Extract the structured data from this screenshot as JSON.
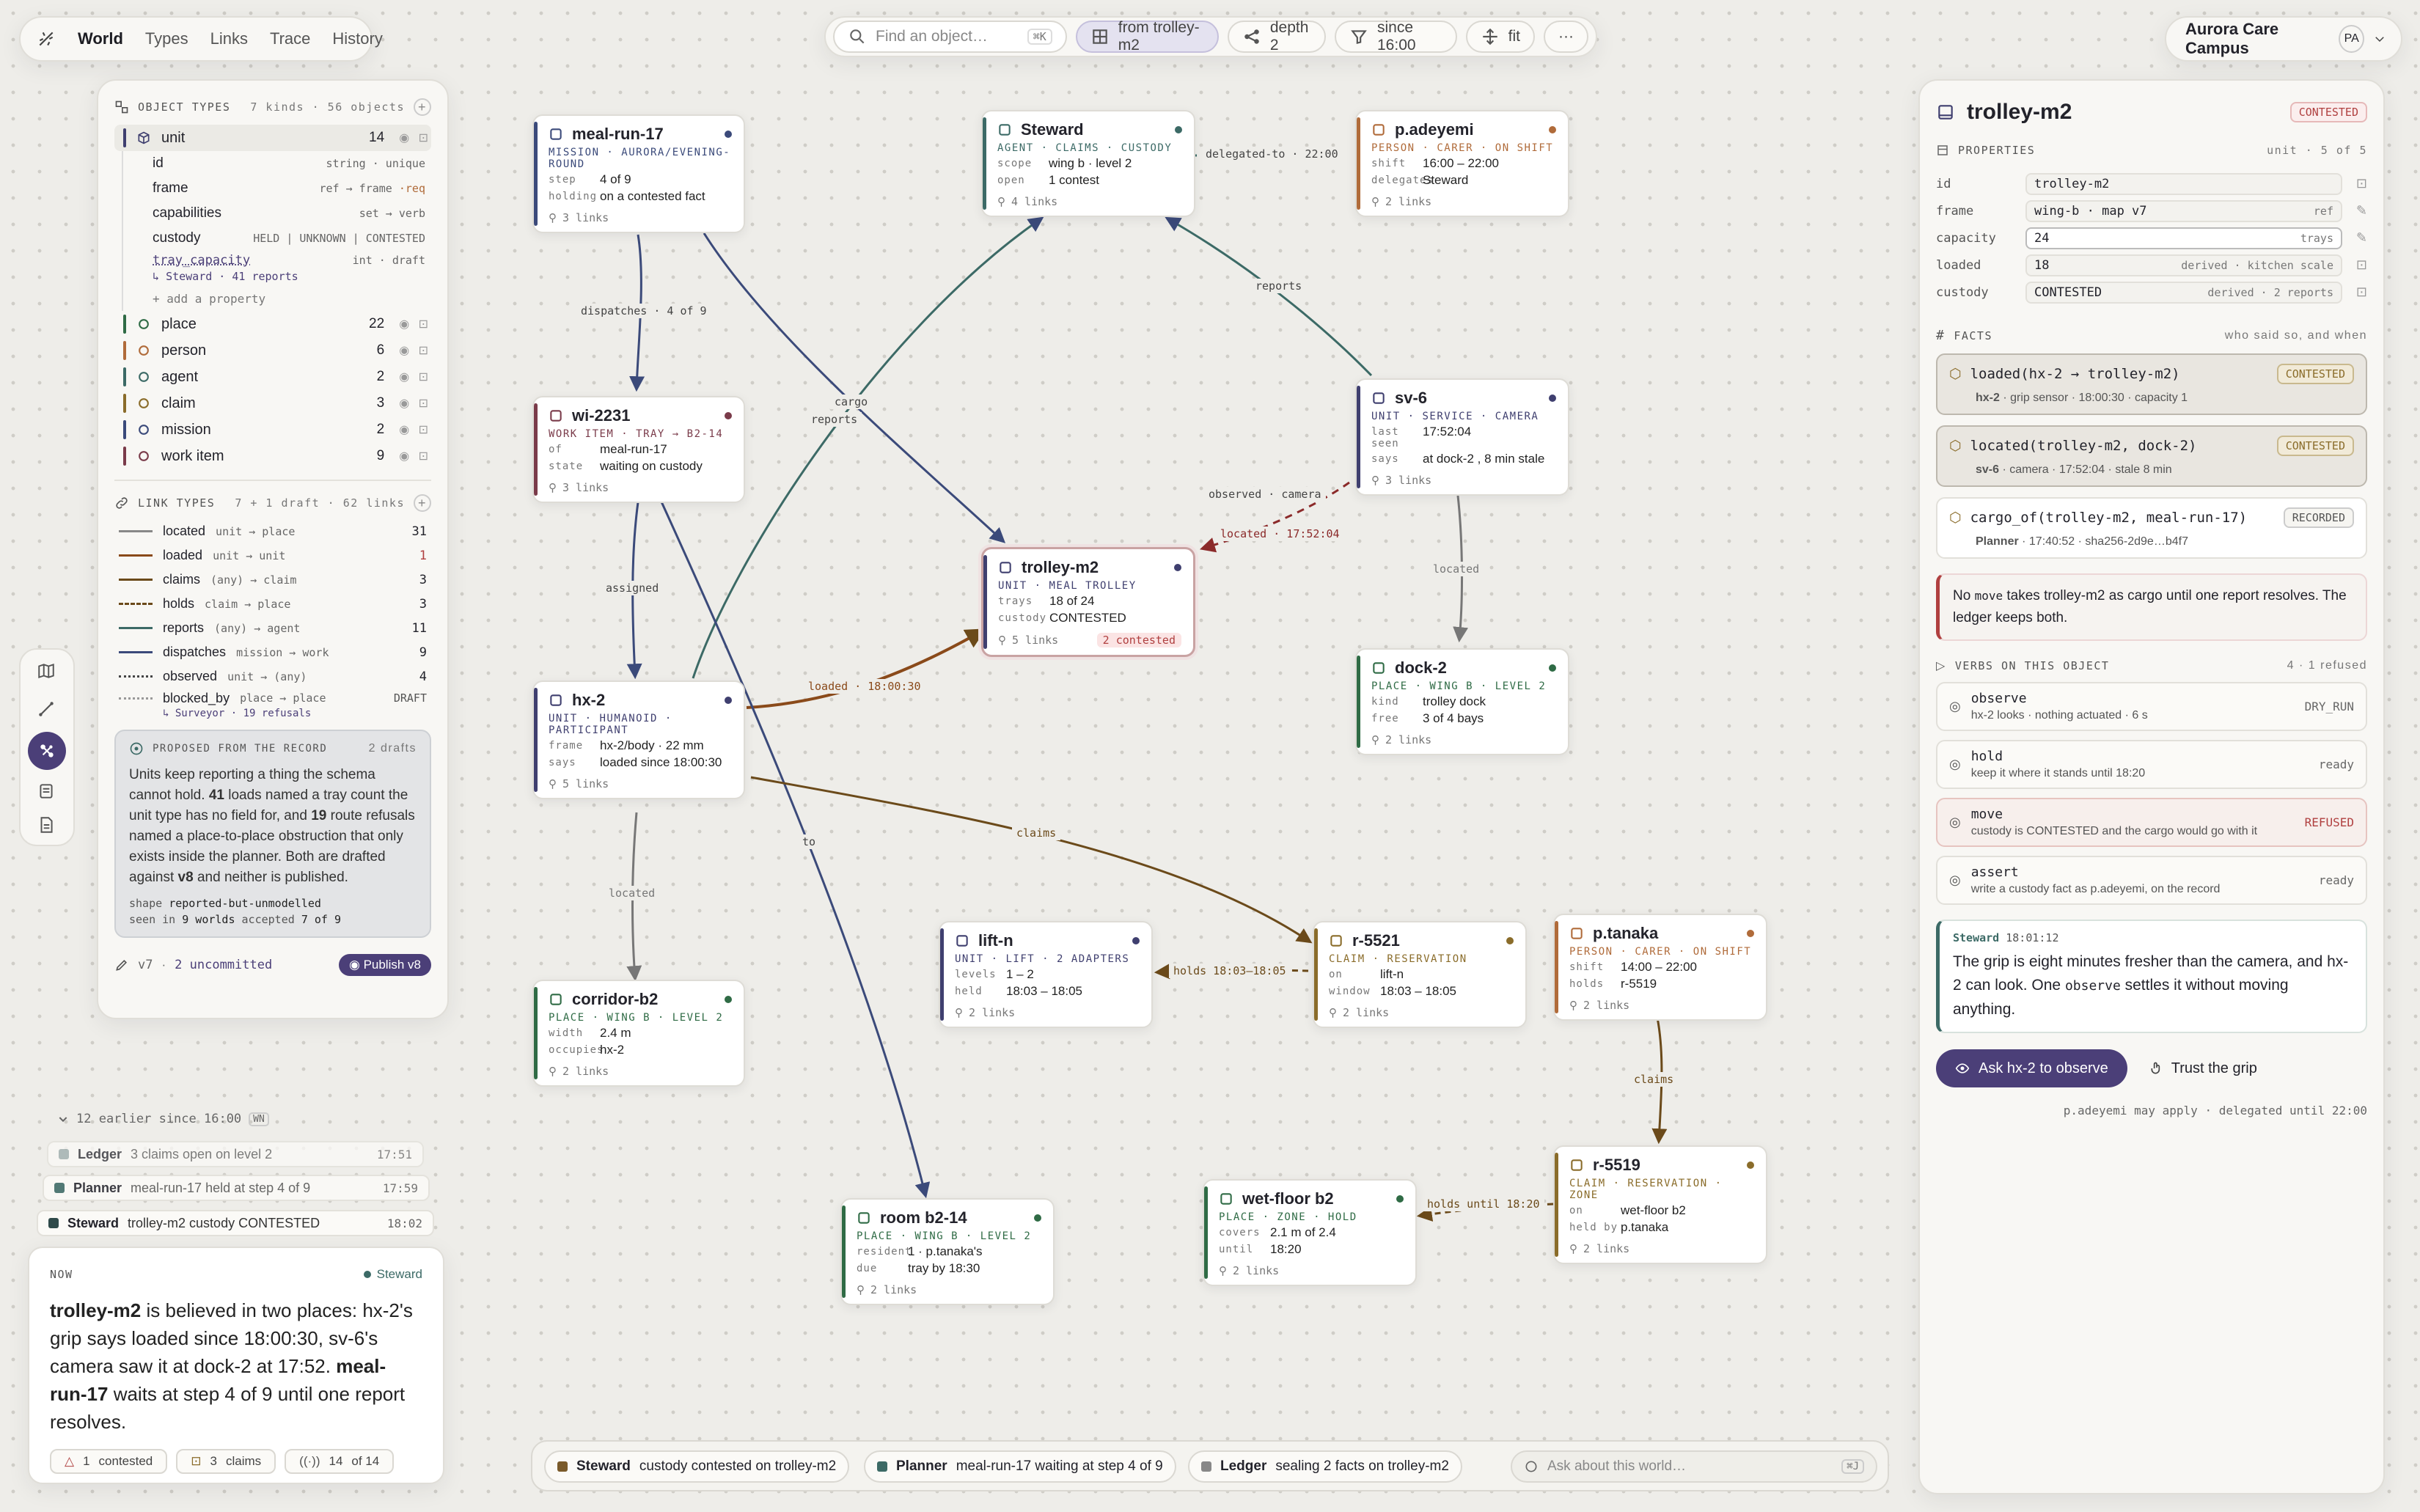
{
  "nav": {
    "title": "World",
    "tabs": [
      "Types",
      "Links",
      "Trace",
      "History"
    ]
  },
  "search": {
    "placeholder": "Find an object…",
    "shortcut": "⌘K",
    "chips": [
      {
        "label": "from trolley-m2"
      },
      {
        "label": "depth 2"
      },
      {
        "label": "since 16:00"
      },
      {
        "label": "fit"
      },
      {
        "label": "···"
      }
    ]
  },
  "campus": {
    "name": "Aurora Care Campus",
    "avatar": "PA"
  },
  "colors": {
    "unit": "#3f3f6f",
    "place": "#2f6b45",
    "person": "#b06b3a",
    "agent": "#3c6a66",
    "claim": "#8a6c2a",
    "mission": "#3b4a7a",
    "work": "#7a3b4a",
    "accent": "#4b3f78",
    "contested": "#b04040"
  },
  "object_types": {
    "header": "OBJECT TYPES",
    "summary": "7 kinds · 56 objects",
    "items": [
      {
        "name": "unit",
        "count": "14"
      },
      {
        "name": "place",
        "count": "22"
      },
      {
        "name": "person",
        "count": "6"
      },
      {
        "name": "agent",
        "count": "2"
      },
      {
        "name": "claim",
        "count": "3"
      },
      {
        "name": "mission",
        "count": "2"
      },
      {
        "name": "work item",
        "count": "9"
      }
    ],
    "unit_props": [
      {
        "name": "id",
        "type": "string · unique"
      },
      {
        "name": "frame",
        "type": "ref → frame ",
        "req": "·req"
      },
      {
        "name": "capabilities",
        "type": "set → verb"
      },
      {
        "name": "custody",
        "type": "HELD | UNKNOWN | CONTESTED"
      }
    ],
    "draft_prop": {
      "name": "tray_capacity",
      "type": "int · draft",
      "note": "Steward · 41 reports"
    },
    "add_prop": "+ add a property"
  },
  "link_types": {
    "header": "LINK TYPES",
    "summary": "7 + 1 draft · 62 links",
    "items": [
      {
        "name": "located",
        "sig": "unit → place",
        "count": "31"
      },
      {
        "name": "loaded",
        "sig": "unit → unit",
        "count": "1"
      },
      {
        "name": "claims",
        "sig": "(any) → claim",
        "count": "3"
      },
      {
        "name": "holds",
        "sig": "claim → place",
        "count": "3"
      },
      {
        "name": "reports",
        "sig": "(any) → agent",
        "count": "11"
      },
      {
        "name": "dispatches",
        "sig": "mission → work",
        "count": "9"
      },
      {
        "name": "observed",
        "sig": "unit → (any)",
        "count": "4"
      }
    ],
    "draft": {
      "name": "blocked_by",
      "sig": "place → place",
      "tag": "DRAFT",
      "note": "Surveyor · 19 refusals"
    }
  },
  "proposed": {
    "title": "PROPOSED FROM THE RECORD",
    "drafts": "2 drafts",
    "body_a": "Units keep reporting a thing the schema cannot hold. ",
    "n1": "41",
    "body_b": " loads named a tray count the unit type has no field for, and ",
    "n2": "19",
    "body_c": " route refusals named a place-to-place obstruction that only exists inside the planner. Both are drafted against ",
    "v": "v8",
    "body_d": " and neither is published.",
    "shape_label": "shape",
    "shape": "reported-but-unmodelled",
    "seen_a": "seen in",
    "seen_n": "9 worlds",
    "acc_a": "accepted",
    "acc_n": "7 of 9"
  },
  "version": {
    "v": "v7",
    "uncommitted": "2 uncommitted",
    "publish": "Publish v8"
  },
  "nodes": {
    "meal": {
      "name": "meal-run-17",
      "sub": "MISSION · AURORA/EVENING-ROUND",
      "kv": [
        [
          "step",
          "4 of 9"
        ],
        [
          "holding",
          "on a contested fact"
        ]
      ],
      "links": "3 links"
    },
    "steward": {
      "name": "Steward",
      "sub": "AGENT · CLAIMS · CUSTODY",
      "kv": [
        [
          "scope",
          "wing b · level 2"
        ],
        [
          "open",
          "1 contest"
        ]
      ],
      "links": "4 links"
    },
    "adeyemi": {
      "name": "p.adeyemi",
      "sub": "PERSON · CARER · ON SHIFT",
      "kv": [
        [
          "shift",
          "16:00 – 22:00"
        ],
        [
          "delegates",
          "Steward"
        ]
      ],
      "links": "2 links"
    },
    "wi": {
      "name": "wi-2231",
      "sub": "WORK ITEM · TRAY → B2-14",
      "kv": [
        [
          "of",
          "meal-run-17"
        ],
        [
          "state",
          "waiting on custody"
        ]
      ],
      "links": "3 links"
    },
    "sv6": {
      "name": "sv-6",
      "sub": "UNIT · SERVICE · CAMERA",
      "kv": [
        [
          "last seen",
          "17:52:04"
        ],
        [
          "says",
          "at dock-2 , 8 min stale"
        ]
      ],
      "links": "3 links"
    },
    "trolley": {
      "name": "trolley-m2",
      "sub": "UNIT · MEAL TROLLEY",
      "kv": [
        [
          "trays",
          "18 of 24"
        ],
        [
          "custody",
          "CONTESTED"
        ]
      ],
      "links": "5 links",
      "contested": "2 contested"
    },
    "hx2": {
      "name": "hx-2",
      "sub": "UNIT · HUMANOID · PARTICIPANT",
      "kv": [
        [
          "frame",
          "hx-2/body · 22 mm"
        ],
        [
          "says",
          "loaded since 18:00:30"
        ]
      ],
      "links": "5 links"
    },
    "dock": {
      "name": "dock-2",
      "sub": "PLACE · WING B · LEVEL 2",
      "kv": [
        [
          "kind",
          "trolley dock"
        ],
        [
          "free",
          "3 of 4 bays"
        ]
      ],
      "links": "2 links"
    },
    "corridor": {
      "name": "corridor-b2",
      "sub": "PLACE · WING B · LEVEL 2",
      "kv": [
        [
          "width",
          "2.4 m"
        ],
        [
          "occupies",
          "hx-2"
        ]
      ],
      "links": "2 links"
    },
    "lift": {
      "name": "lift-n",
      "sub": "UNIT · LIFT · 2 ADAPTERS",
      "kv": [
        [
          "levels",
          "1 – 2"
        ],
        [
          "held",
          "18:03 – 18:05"
        ]
      ],
      "links": "2 links"
    },
    "r5521": {
      "name": "r-5521",
      "sub": "CLAIM · RESERVATION",
      "kv": [
        [
          "on",
          "lift-n"
        ],
        [
          "window",
          "18:03 – 18:05"
        ]
      ],
      "links": "2 links"
    },
    "tanaka": {
      "name": "p.tanaka",
      "sub": "PERSON · CARER · ON SHIFT",
      "kv": [
        [
          "shift",
          "14:00 – 22:00"
        ],
        [
          "holds",
          "r-5519"
        ]
      ],
      "links": "2 links"
    },
    "room": {
      "name": "room b2-14",
      "sub": "PLACE · WING B · LEVEL 2",
      "kv": [
        [
          "resident",
          "1 · p.tanaka's"
        ],
        [
          "due",
          "tray by 18:30"
        ]
      ],
      "links": "2 links"
    },
    "wetfloor": {
      "name": "wet-floor b2",
      "sub": "PLACE · ZONE · HOLD",
      "kv": [
        [
          "covers",
          "2.1 m of 2.4"
        ],
        [
          "until",
          "18:20"
        ]
      ],
      "links": "2 links"
    },
    "r5519": {
      "name": "r-5519",
      "sub": "CLAIM · RESERVATION · ZONE",
      "kv": [
        [
          "on",
          "wet-floor b2"
        ],
        [
          "held by",
          "p.tanaka"
        ]
      ],
      "links": "2 links"
    }
  },
  "edges": {
    "dispatches": "dispatches · 4 of 9",
    "cargo": "cargo",
    "reports1": "reports",
    "delegated": "delegated-to · 22:00",
    "reports2": "reports",
    "observed": "observed · camera",
    "located1": "located · 17:52:04",
    "located2": "located",
    "assigned": "assigned",
    "loaded": "loaded · 18:00:30",
    "located3": "located",
    "to": "to",
    "claims1": "claims",
    "holds1": "holds 18:03–18:05",
    "claims2": "claims",
    "holds2": "holds until 18:20"
  },
  "history": {
    "toggle": "12 earlier since 16:00",
    "key": "WN",
    "items": [
      {
        "who": "Ledger",
        "what": "3 claims open on level 2",
        "time": "17:51"
      },
      {
        "who": "Planner",
        "what": "meal-run-17 held at step 4 of 9",
        "time": "17:59"
      },
      {
        "who": "Steward",
        "what": "trolley-m2 custody CONTESTED",
        "time": "18:02"
      }
    ]
  },
  "now": {
    "label": "NOW",
    "by": "Steward",
    "t1": "trolley-m2",
    "t2": " is believed in two places: hx-2's grip says loaded since 18:00:30, sv-6's camera saw it at dock-2 at 17:52. ",
    "t3": "meal-run-17",
    "t4": " waits at step 4 of 9 until one report resolves.",
    "chips": [
      {
        "n": "1",
        "l": "contested"
      },
      {
        "n": "3",
        "l": "claims"
      },
      {
        "n": "14",
        "l": "of 14"
      }
    ]
  },
  "bottom": {
    "items": [
      {
        "who": "Steward",
        "what": "custody contested on trolley-m2"
      },
      {
        "who": "Planner",
        "what": "meal-run-17 waiting at step 4 of 9"
      },
      {
        "who": "Ledger",
        "what": "sealing 2 facts on trolley-m2"
      }
    ],
    "ask_placeholder": "Ask about this world…",
    "ask_key": "⌘J"
  },
  "inspector": {
    "title": "trolley-m2",
    "status": "CONTESTED",
    "props_header": "PROPERTIES",
    "props_meta": "unit · 5 of 5",
    "props": [
      {
        "k": "id",
        "v": "trolley-m2",
        "tag": ""
      },
      {
        "k": "frame",
        "v": "wing-b · map v7",
        "tag": "ref"
      },
      {
        "k": "capacity",
        "v": "24",
        "tag": "trays"
      },
      {
        "k": "loaded",
        "v": "18",
        "tag": "derived · kitchen scale"
      },
      {
        "k": "custody",
        "v": "CONTESTED",
        "tag": "derived · 2 reports"
      }
    ],
    "facts_header": "FACTS",
    "facts_meta": "who said so, and when",
    "facts": [
      {
        "t": "loaded(hx-2 → trolley-m2)",
        "status": "CONTESTED",
        "who": "hx-2",
        "src": " · grip sensor · 18:00:30 · capacity 1"
      },
      {
        "t": "located(trolley-m2, dock-2)",
        "status": "CONTESTED",
        "who": "sv-6",
        "src": " · camera · 17:52:04 · stale 8 min"
      },
      {
        "t": "cargo_of(trolley-m2, meal-run-17)",
        "status": "RECORDED",
        "who": "Planner",
        "src": " · 17:40:52 · sha256-2d9e…b4f7"
      }
    ],
    "warn_a": "No ",
    "warn_code": "move",
    "warn_b": " takes trolley-m2 as cargo until one report resolves. The ledger keeps both.",
    "verbs_header": "VERBS ON THIS OBJECT",
    "verbs_meta": "4 · 1 refused",
    "verbs": [
      {
        "n": "observe",
        "d": "hx-2 looks · nothing actuated · 6 s",
        "s": "DRY_RUN"
      },
      {
        "n": "hold",
        "d": "keep it where it stands until 18:20",
        "s": "ready"
      },
      {
        "n": "move",
        "d": "custody is CONTESTED and the cargo would go with it",
        "s": "REFUSED"
      },
      {
        "n": "assert",
        "d": "write a custody fact as p.adeyemi, on the record",
        "s": "ready"
      }
    ],
    "note_who": "Steward",
    "note_time": "18:01:12",
    "note_a": "The grip is eight minutes fresher than the camera, and hx-2 can look. One ",
    "note_code": "observe",
    "note_b": " settles it without moving anything.",
    "primary": "Ask hx-2 to observe",
    "secondary": "Trust the grip",
    "footer": "p.adeyemi may apply · delegated until 22:00"
  }
}
